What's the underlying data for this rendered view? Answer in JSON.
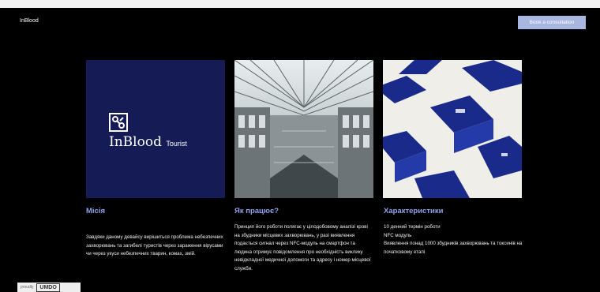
{
  "header": {
    "brand": "InBlood",
    "cta_label": "Book a consultation"
  },
  "card1": {
    "logo_main": "InBlood",
    "logo_sub": "Tourist",
    "title": "Місія",
    "text": "Завдяки даному девайсу вирішиться проблема небезпечних захворювань та загибелі туристів через зараження вірусами чи через укуси небезпечних тварин, комах, змій."
  },
  "card2": {
    "title": "Як працює?",
    "text": "Принцип його роботи полягає у цілодобовому аналізі крові на збудники місцевих захворювань, у разі виявлення подається сигнал через NFC-модуль на смартфон та людина отримує повідомлення про необхідність виклику невідкладної медичної допомоги та адресу і номер місцевої служби."
  },
  "card3": {
    "title": "Характеристики",
    "text": "10 денний термін роботи\nNFC модуль\nВиявлення понад 1000 збудників захворювань та токсинів на початковому етапі"
  },
  "badge": {
    "left": "proudly",
    "right": "UMDO"
  },
  "colors": {
    "accent_title": "#8fa2e8",
    "cta_bg": "#a9b7e0",
    "brand_navy": "#151c55"
  }
}
